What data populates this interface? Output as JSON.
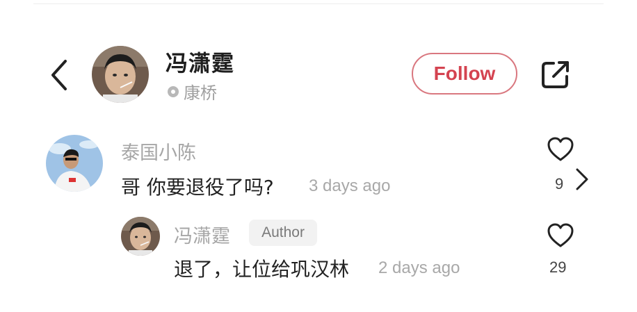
{
  "header": {
    "back_icon": "chevron-left-icon",
    "user_name": "冯潇霆",
    "location": "康桥",
    "location_icon": "location-pin-icon",
    "follow_label": "Follow",
    "share_icon": "share-external-icon",
    "accent_color": "#d44350"
  },
  "comments": [
    {
      "author": "泰国小陈",
      "text": "哥 你要退役了吗?",
      "time": "3 days ago",
      "likes": "9",
      "like_icon": "heart-outline-icon",
      "expand_icon": "chevron-right-icon"
    }
  ],
  "replies": [
    {
      "author": "冯潇霆",
      "badge": "Author",
      "text": "退了，让位给巩汉林",
      "time": "2 days ago",
      "likes": "29",
      "like_icon": "heart-outline-icon"
    }
  ]
}
